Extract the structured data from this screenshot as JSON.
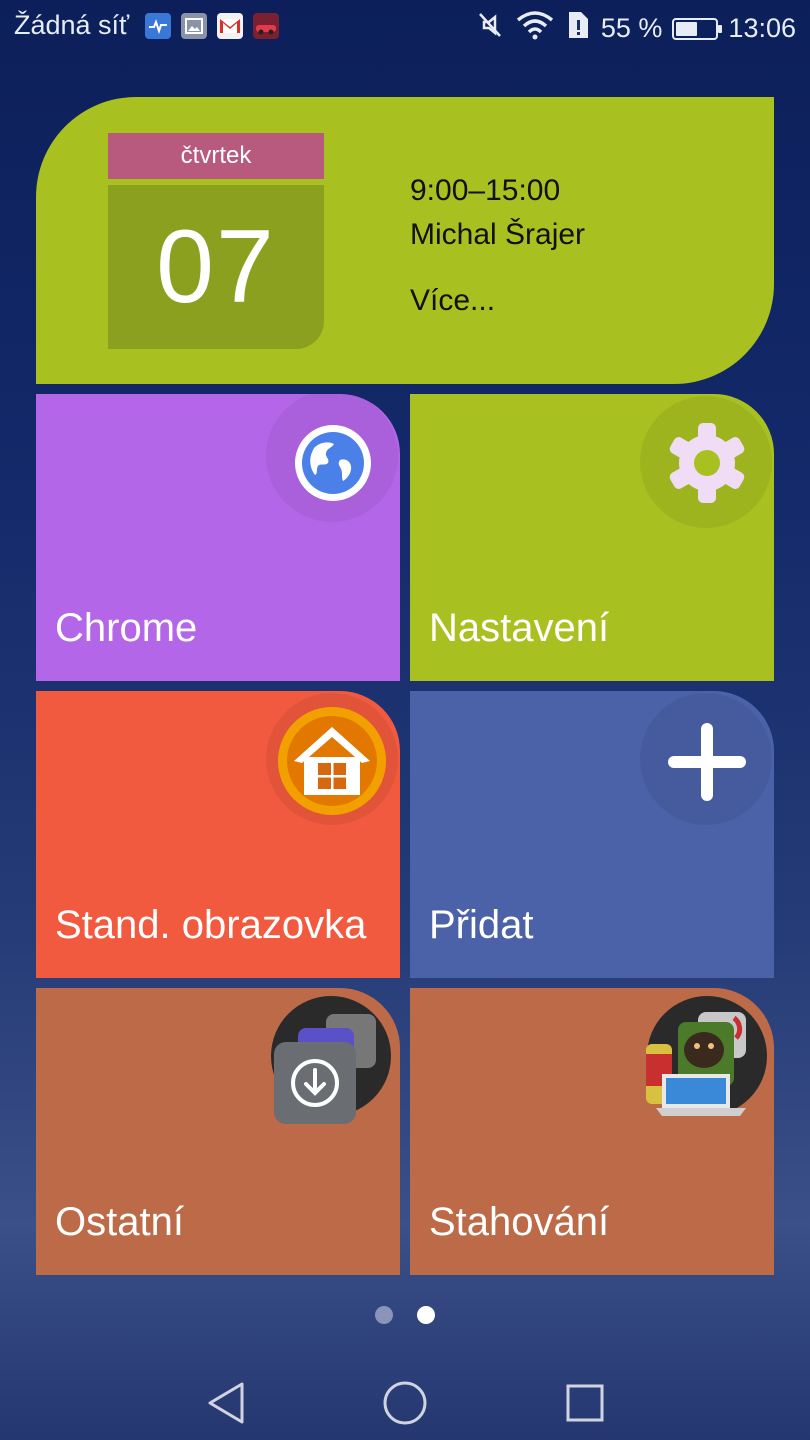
{
  "status_bar": {
    "carrier": "Žádná síť",
    "battery_text": "55 %",
    "battery_level": 0.55,
    "time": "13:06",
    "notification_icons": [
      "health-icon",
      "gallery-icon",
      "gmail-icon",
      "csr-racing-icon"
    ],
    "system_icons": [
      "mute-icon",
      "wifi-icon",
      "sim-alert-icon",
      "battery-icon"
    ]
  },
  "calendar": {
    "weekday": "čtvrtek",
    "day": "07",
    "event_time": "9:00–15:00",
    "event_name": "Michal Šrajer",
    "more_link": "Více..."
  },
  "tiles": [
    {
      "label": "Chrome",
      "icon": "globe-icon",
      "color": "#b466e8"
    },
    {
      "label": "Nastavení",
      "icon": "gear-icon",
      "color": "#a8c020"
    },
    {
      "label": "Stand. obrazovka",
      "icon": "home-icon",
      "color": "#f15a3e"
    },
    {
      "label": "Přidat",
      "icon": "plus-icon",
      "color": "#4b61a8"
    },
    {
      "label": "Ostatní",
      "icon": "download-folder-icon",
      "color": "#bd6a48"
    },
    {
      "label": "Stahování",
      "icon": "downloads-folder-icon",
      "color": "#bd6a48"
    }
  ],
  "pager": {
    "pages": 2,
    "active_index": 1
  },
  "nav_bar": {
    "buttons": [
      "back-icon",
      "home-nav-icon",
      "recents-icon"
    ]
  }
}
